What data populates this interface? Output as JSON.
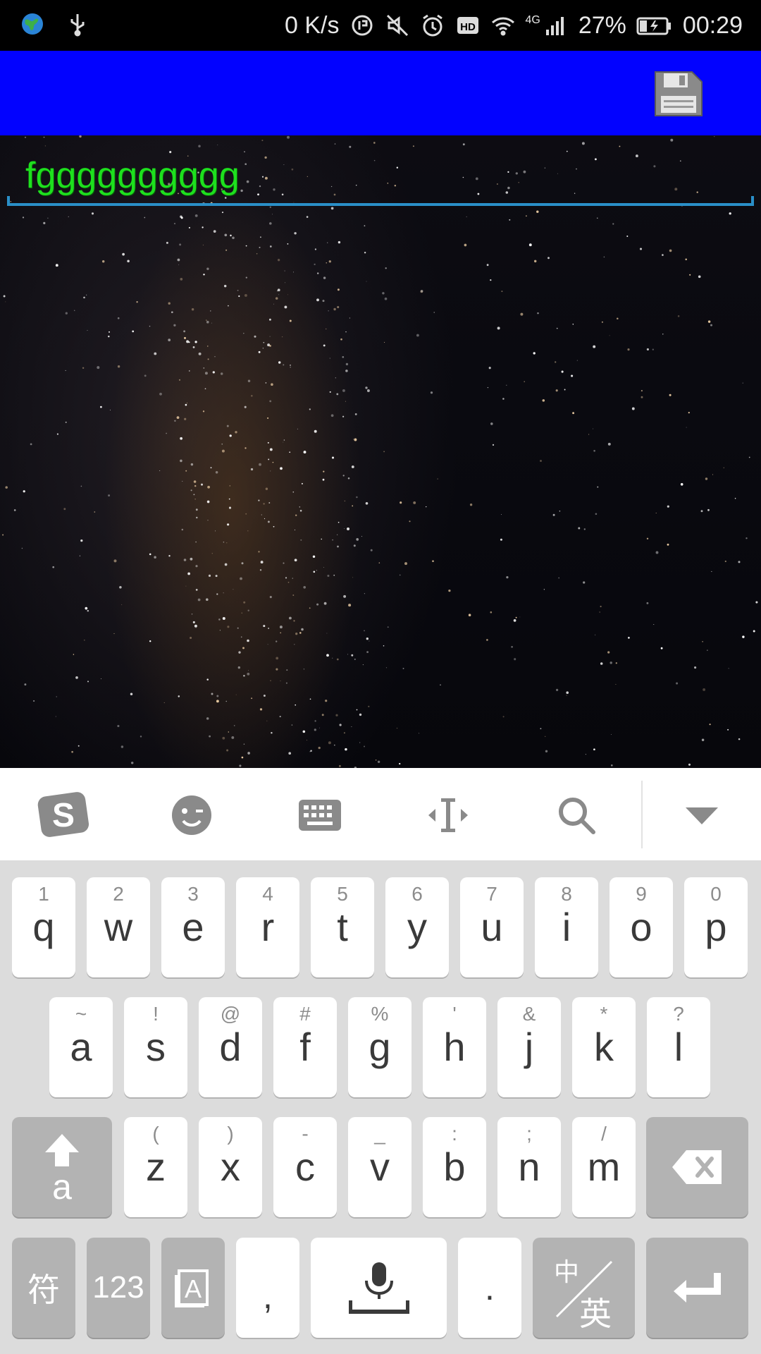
{
  "status_bar": {
    "net_speed": "0 K/s",
    "network_type": "4G",
    "battery": "27%",
    "time": "00:29",
    "icons": [
      "earth-icon",
      "usb-icon",
      "data-saver-icon",
      "mute-icon",
      "alarm-icon",
      "hd-icon",
      "wifi-icon",
      "signal-icon",
      "battery-charging-icon"
    ]
  },
  "app_bar": {
    "background": "#0202ff",
    "actions": [
      "save-icon"
    ]
  },
  "editor": {
    "value": "fgggggggggg",
    "text_color": "#1ee01e",
    "underline_color": "#2a8fc8"
  },
  "keyboard_toolbar": {
    "icons": [
      "sogou-logo-icon",
      "emoji-icon",
      "keyboard-icon",
      "cursor-move-icon",
      "search-icon",
      "collapse-icon"
    ]
  },
  "keyboard": {
    "row1": [
      {
        "hint": "1",
        "key": "q"
      },
      {
        "hint": "2",
        "key": "w"
      },
      {
        "hint": "3",
        "key": "e"
      },
      {
        "hint": "4",
        "key": "r"
      },
      {
        "hint": "5",
        "key": "t"
      },
      {
        "hint": "6",
        "key": "y"
      },
      {
        "hint": "7",
        "key": "u"
      },
      {
        "hint": "8",
        "key": "i"
      },
      {
        "hint": "9",
        "key": "o"
      },
      {
        "hint": "0",
        "key": "p"
      }
    ],
    "row2": [
      {
        "hint": "~",
        "key": "a"
      },
      {
        "hint": "!",
        "key": "s"
      },
      {
        "hint": "@",
        "key": "d"
      },
      {
        "hint": "#",
        "key": "f"
      },
      {
        "hint": "%",
        "key": "g"
      },
      {
        "hint": "'",
        "key": "h"
      },
      {
        "hint": "&",
        "key": "j"
      },
      {
        "hint": "*",
        "key": "k"
      },
      {
        "hint": "?",
        "key": "l"
      }
    ],
    "row3": [
      {
        "hint": "(",
        "key": "z"
      },
      {
        "hint": ")",
        "key": "x"
      },
      {
        "hint": "-",
        "key": "c"
      },
      {
        "hint": "_",
        "key": "v"
      },
      {
        "hint": ":",
        "key": "b"
      },
      {
        "hint": ";",
        "key": "n"
      },
      {
        "hint": "/",
        "key": "m"
      }
    ],
    "shift_label": "a",
    "symbols_label": "符",
    "numbers_label": "123",
    "comma_label": ",",
    "period_label": ".",
    "lang_top": "中",
    "lang_bottom": "英"
  }
}
